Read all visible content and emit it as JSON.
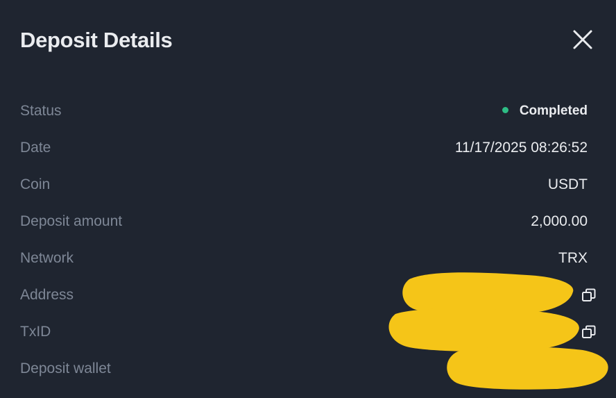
{
  "dialog": {
    "title": "Deposit Details",
    "close_icon": "close-icon"
  },
  "details": {
    "status": {
      "label": "Status",
      "value": "Completed",
      "dot_color": "#2ebd85"
    },
    "date": {
      "label": "Date",
      "value": "11/17/2025 08:26:52"
    },
    "coin": {
      "label": "Coin",
      "value": "USDT"
    },
    "amount": {
      "label": "Deposit amount",
      "value": "2,000.00"
    },
    "network": {
      "label": "Network",
      "value": "TRX"
    },
    "address": {
      "label": "Address",
      "link_icon": "link-icon",
      "copy_icon": "copy-icon"
    },
    "txid": {
      "label": "TxID",
      "link_icon": "link-icon",
      "copy_icon": "copy-icon"
    },
    "wallet": {
      "label": "Deposit wallet"
    }
  },
  "colors": {
    "background": "#1f2530",
    "label": "#7e8796",
    "value": "#eaecef",
    "redaction": "#f5c518"
  }
}
